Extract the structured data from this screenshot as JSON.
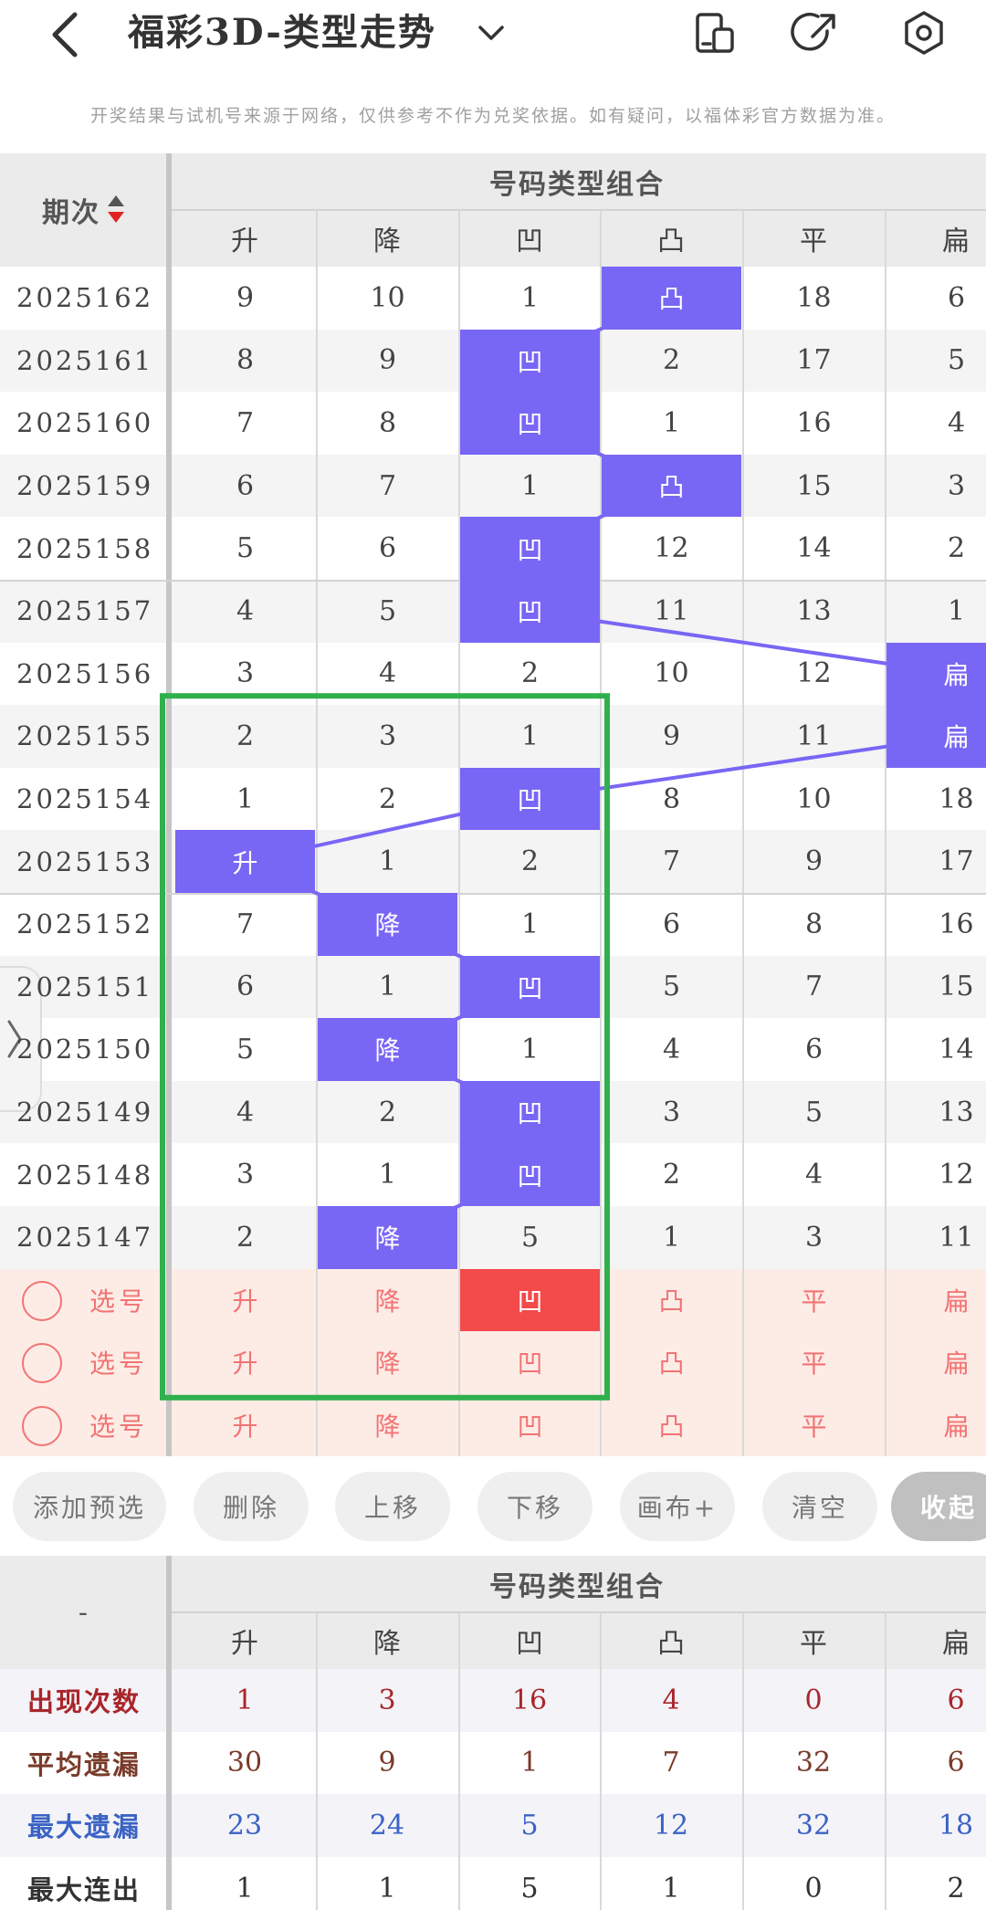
{
  "header": {
    "title": "福彩3D-类型走势",
    "notice": "开奖结果与试机号来源于网络，仅供参考不作为兑奖依据。如有疑问，以福体彩官方数据为准。"
  },
  "table": {
    "period_header": "期次",
    "group_header": "号码类型组合",
    "columns": [
      "升",
      "降",
      "凹",
      "凸",
      "平",
      "扁"
    ],
    "rows": [
      {
        "period": "2025162",
        "values": [
          "9",
          "10",
          "1",
          "凸",
          "18",
          "6"
        ],
        "hit": 3
      },
      {
        "period": "2025161",
        "values": [
          "8",
          "9",
          "凹",
          "2",
          "17",
          "5"
        ],
        "hit": 2
      },
      {
        "period": "2025160",
        "values": [
          "7",
          "8",
          "凹",
          "1",
          "16",
          "4"
        ],
        "hit": 2
      },
      {
        "period": "2025159",
        "values": [
          "6",
          "7",
          "1",
          "凸",
          "15",
          "3"
        ],
        "hit": 3
      },
      {
        "period": "2025158",
        "values": [
          "5",
          "6",
          "凹",
          "12",
          "14",
          "2"
        ],
        "hit": 2
      },
      {
        "period": "2025157",
        "values": [
          "4",
          "5",
          "凹",
          "11",
          "13",
          "1"
        ],
        "hit": 2
      },
      {
        "period": "2025156",
        "values": [
          "3",
          "4",
          "2",
          "10",
          "12",
          "扁"
        ],
        "hit": 5
      },
      {
        "period": "2025155",
        "values": [
          "2",
          "3",
          "1",
          "9",
          "11",
          "扁"
        ],
        "hit": 5
      },
      {
        "period": "2025154",
        "values": [
          "1",
          "2",
          "凹",
          "8",
          "10",
          "18"
        ],
        "hit": 2
      },
      {
        "period": "2025153",
        "values": [
          "升",
          "1",
          "2",
          "7",
          "9",
          "17"
        ],
        "hit": 0
      },
      {
        "period": "2025152",
        "values": [
          "7",
          "降",
          "1",
          "6",
          "8",
          "16"
        ],
        "hit": 1
      },
      {
        "period": "2025151",
        "values": [
          "6",
          "1",
          "凹",
          "5",
          "7",
          "15"
        ],
        "hit": 2
      },
      {
        "period": "2025150",
        "values": [
          "5",
          "降",
          "1",
          "4",
          "6",
          "14"
        ],
        "hit": 1
      },
      {
        "period": "2025149",
        "values": [
          "4",
          "2",
          "凹",
          "3",
          "5",
          "13"
        ],
        "hit": 2
      },
      {
        "period": "2025148",
        "values": [
          "3",
          "1",
          "凹",
          "2",
          "4",
          "12"
        ],
        "hit": 2
      },
      {
        "period": "2025147",
        "values": [
          "2",
          "降",
          "5",
          "1",
          "3",
          "11"
        ],
        "hit": 1
      }
    ],
    "pick_rows": [
      {
        "label": "选号",
        "selected": 2
      },
      {
        "label": "选号",
        "selected": -1
      },
      {
        "label": "选号",
        "selected": -1
      }
    ]
  },
  "buttons": [
    "添加预选",
    "删除",
    "上移",
    "下移",
    "画布+",
    "清空",
    "收起"
  ],
  "stats": {
    "corner": "-",
    "group_header": "号码类型组合",
    "rows": [
      {
        "label": "出现次数",
        "values": [
          "1",
          "3",
          "16",
          "4",
          "0",
          "6"
        ],
        "color": "#a8262b"
      },
      {
        "label": "平均遗漏",
        "values": [
          "30",
          "9",
          "1",
          "7",
          "32",
          "6"
        ],
        "color": "#7a3b2a"
      },
      {
        "label": "最大遗漏",
        "values": [
          "23",
          "24",
          "5",
          "12",
          "32",
          "18"
        ],
        "color": "#3a63c4"
      },
      {
        "label": "最大连出",
        "values": [
          "1",
          "1",
          "5",
          "1",
          "0",
          "2"
        ],
        "color": "#333333"
      }
    ]
  },
  "colors": {
    "hit": "#7866f4",
    "selected": "#f34a4a",
    "pick_bg": "#fdece6",
    "overlay_box": "#2fb04c"
  }
}
